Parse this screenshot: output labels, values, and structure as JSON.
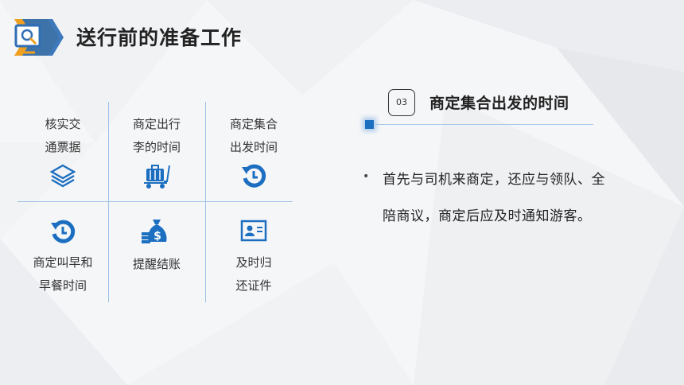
{
  "title": "送行前的准备工作",
  "logo": {
    "icon": "magnifier-slide-icon",
    "colors": {
      "orange": "#f0a020",
      "blue": "#2f6fb5"
    }
  },
  "grid": [
    {
      "label": "核实交\n通票据",
      "icon": "stack-layers-icon"
    },
    {
      "label": "商定出行\n李的时间",
      "icon": "luggage-cart-icon"
    },
    {
      "label": "商定集合\n出发时间",
      "icon": "history-clock-icon"
    },
    {
      "label": "商定叫早和\n早餐时间",
      "icon": "history-clock-icon"
    },
    {
      "label": "提醒结账",
      "icon": "money-bag-icon"
    },
    {
      "label": "及时归\n还证件",
      "icon": "id-card-icon"
    }
  ],
  "section": {
    "number": "03",
    "heading": "商定集合出发的时间",
    "bullet": "•",
    "text": "首先与司机来商定，还应与领队、全陪商议，商定后应及时通知游客。"
  },
  "colors": {
    "accent": "#1c6fc0",
    "divider": "#9fc2e6",
    "text": "#222222"
  }
}
